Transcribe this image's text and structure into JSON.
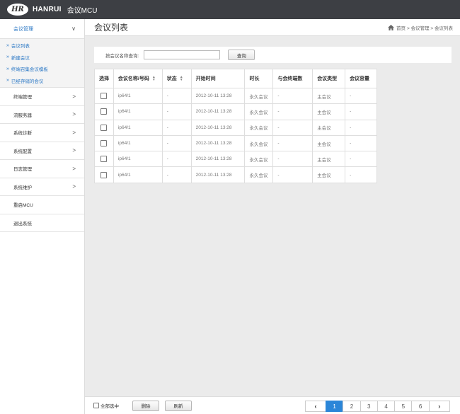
{
  "header": {
    "logo_text": "HR",
    "brand": "HANRUI",
    "app_title": "会议MCU"
  },
  "sidebar": {
    "active_group": {
      "label": "会议管理",
      "chevron": "∨"
    },
    "subitems": [
      {
        "label": "会议列表"
      },
      {
        "label": "新建会议"
      },
      {
        "label": "终端召集会议模板"
      },
      {
        "label": "已经存储的会议"
      }
    ],
    "items": [
      {
        "label": "终端管理",
        "chevron": ">"
      },
      {
        "label": "流服务器",
        "chevron": ">"
      },
      {
        "label": "系统诊断",
        "chevron": ">"
      },
      {
        "label": "系统配置",
        "chevron": ">"
      },
      {
        "label": "日志管理",
        "chevron": ">"
      },
      {
        "label": "系统维护",
        "chevron": ">"
      },
      {
        "label": "重启MCU",
        "chevron": ""
      },
      {
        "label": "退出系统",
        "chevron": ""
      }
    ]
  },
  "page": {
    "title": "会议列表",
    "breadcrumb": "首页 > 会议管理 > 会议列表"
  },
  "search": {
    "label": "按会议名称查询:",
    "value": "",
    "button": "查询"
  },
  "table": {
    "headers": [
      "选择",
      "会议名称/号码",
      "状态",
      "开始时间",
      "时长",
      "与会终端数",
      "会议类型",
      "会议容量"
    ],
    "rows": [
      [
        "ip64/1",
        "-",
        "2012-10-11 13:28",
        "永久会议",
        "-",
        "主会议",
        "-"
      ],
      [
        "ip64/1",
        "-",
        "2012-10-11 13:28",
        "永久会议",
        "-",
        "主会议",
        "-"
      ],
      [
        "ip64/1",
        "-",
        "2012-10-11 13:28",
        "永久会议",
        "-",
        "主会议",
        "-"
      ],
      [
        "ip64/1",
        "-",
        "2012-10-11 13:28",
        "永久会议",
        "-",
        "主会议",
        "-"
      ],
      [
        "ip64/1",
        "-",
        "2012-10-11 13:28",
        "永久会议",
        "-",
        "主会议",
        "-"
      ],
      [
        "ip64/1",
        "-",
        "2012-10-11 13:28",
        "永久会议",
        "-",
        "主会议",
        "-"
      ]
    ]
  },
  "footer": {
    "select_all": "全部选中",
    "delete": "删除",
    "refresh": "刷新",
    "pages": [
      "1",
      "2",
      "3",
      "4",
      "5",
      "6"
    ],
    "current_page": "1",
    "prev": "‹",
    "next": "›"
  },
  "colors": {
    "topbar": "#3d3f44",
    "accent": "#2b78c5",
    "active_page": "#2b86d8"
  }
}
